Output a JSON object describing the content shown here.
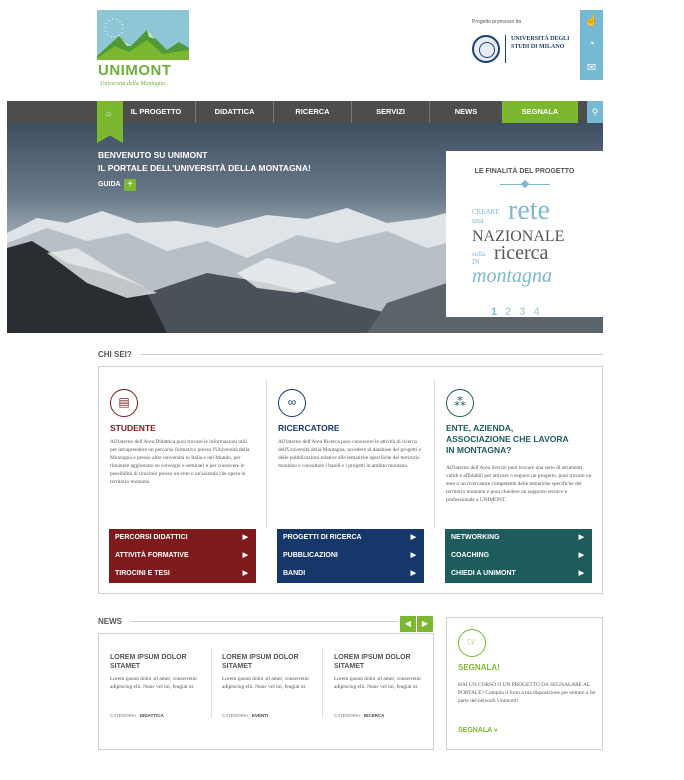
{
  "header": {
    "logo_title": "UNIMONT",
    "logo_subtitle": "Università della Montagna",
    "promoter_label": "Progetto promosso da",
    "unimi_name": "UNIVERSITÀ DEGLI STUDI DI MILANO",
    "side_icons": [
      "hand-icon",
      "rss-icon",
      "mail-icon"
    ]
  },
  "nav": {
    "items": [
      "IL PROGETTO",
      "DIDATTICA",
      "RICERCA",
      "SERVIZI",
      "NEWS"
    ],
    "highlight": "SEGNALA",
    "search_icon": "search-icon"
  },
  "hero": {
    "title_line1": "BENVENUTO SU UNIMONT",
    "title_line2": "IL PORTALE DELL'UNIVERSITÀ DELLA MONTAGNA!",
    "guide_label": "GUIDA",
    "guide_plus": "+",
    "card_title": "LE FINALITÀ DEL PROGETTO",
    "card_creare": "CREARE",
    "card_una": "una",
    "card_rete": "rete",
    "card_nazionale": "NAZIONALE",
    "card_sulla": "sulla",
    "card_in": "IN",
    "card_ricerca": "ricerca",
    "card_montagna": "montagna",
    "pager": [
      "1",
      "2",
      "3",
      "4"
    ],
    "pager_active": 0
  },
  "chi_sei": {
    "title": "CHI SEI?",
    "columns": [
      {
        "icon": "book-icon",
        "title": "STUDENTE",
        "text": "All'interno dell'Area Didattica puoi trovare le informazioni utili per intraprendere un percorso formativo presso l'Università della Montagna e presso altre università in Italia e nel Mondo, per rimanere aggiornato su convegni e seminari e per conoscere le possibilità di tirocinio presso un ente o un'azienda che opera in territorio montano.",
        "menu": [
          "PERCORSI DIDATTICI",
          "ATTIVITÀ FORMATIVE",
          "TIROCINI E TESI"
        ]
      },
      {
        "icon": "glasses-icon",
        "title": "RICERCATORE",
        "text": "All'interno dell'Area Ricerca puoi conoscere le attività di ricerca dell'Università della Montagna, accedere al database dei progetti e delle pubblicazioni relative alle tematiche specifiche del territorio montano e consultare i bandi e i progetti in ambito montano.",
        "menu": [
          "PROGETTI DI RICERCA",
          "PUBBLICAZIONI",
          "BANDI"
        ]
      },
      {
        "icon": "network-icon",
        "title_line1": "ENTE, AZIENDA,",
        "title_line2": "ASSOCIAZIONE CHE LAVORA",
        "title_line3": "IN MONTAGNA?",
        "text": "All'interno dell'Area Servizi puoi trovare una serie di strumenti validi e affidabili per attivare o seguire un progetto, puoi trovare un ente o un ricercatore competente delle tematiche specifiche del territorio montano e puoi chiedere un supporto tecnico e professionale a UNIMONT.",
        "menu": [
          "NETWORKING",
          "COACHING",
          "CHIEDI A UNIMONT"
        ]
      }
    ]
  },
  "news": {
    "title": "NEWS",
    "prev_icon": "chevron-left-icon",
    "next_icon": "chevron-right-icon",
    "items": [
      {
        "title": "LOREM IPSUM DOLOR SITAMET",
        "text": "Lorem ipsum dolor sit amet, consectetur adipiscing elit. Nunc vel mi, feugiat ut.",
        "meta_label": "CATEGORIA",
        "meta_value": "DIDATTICA"
      },
      {
        "title": "LOREM IPSUM DOLOR SITAMET",
        "text": "Lorem ipsum dolor sit amet, consectetur adipiscing elit. Nunc vel mi, feugiat ut.",
        "meta_label": "CATEGORIA",
        "meta_value": "EVENTI"
      },
      {
        "title": "LOREM IPSUM DOLOR SITAMET",
        "text": "Lorem ipsum dolor sit amet, consectetur adipiscing elit. Nunc vel mi, feugiat ut.",
        "meta_label": "CATEGORIA",
        "meta_value": "RICERCA"
      }
    ]
  },
  "segnala": {
    "icon": "pointing-hand-icon",
    "title": "SEGNALA!",
    "text": "HAI UN CORSO O UN PROGETTO DA SEGNALARE AL PORTALE? Compila il form a tua disposizione per entrare a far parte del network Unimont!",
    "link": "SEGNALA »"
  },
  "colors": {
    "green": "#7cb82f",
    "blue": "#76b9d3",
    "nav_gray": "#4e4d4d",
    "studente": "#7f1a1c",
    "ricercatore": "#16376a",
    "ente": "#1d5b5d"
  }
}
